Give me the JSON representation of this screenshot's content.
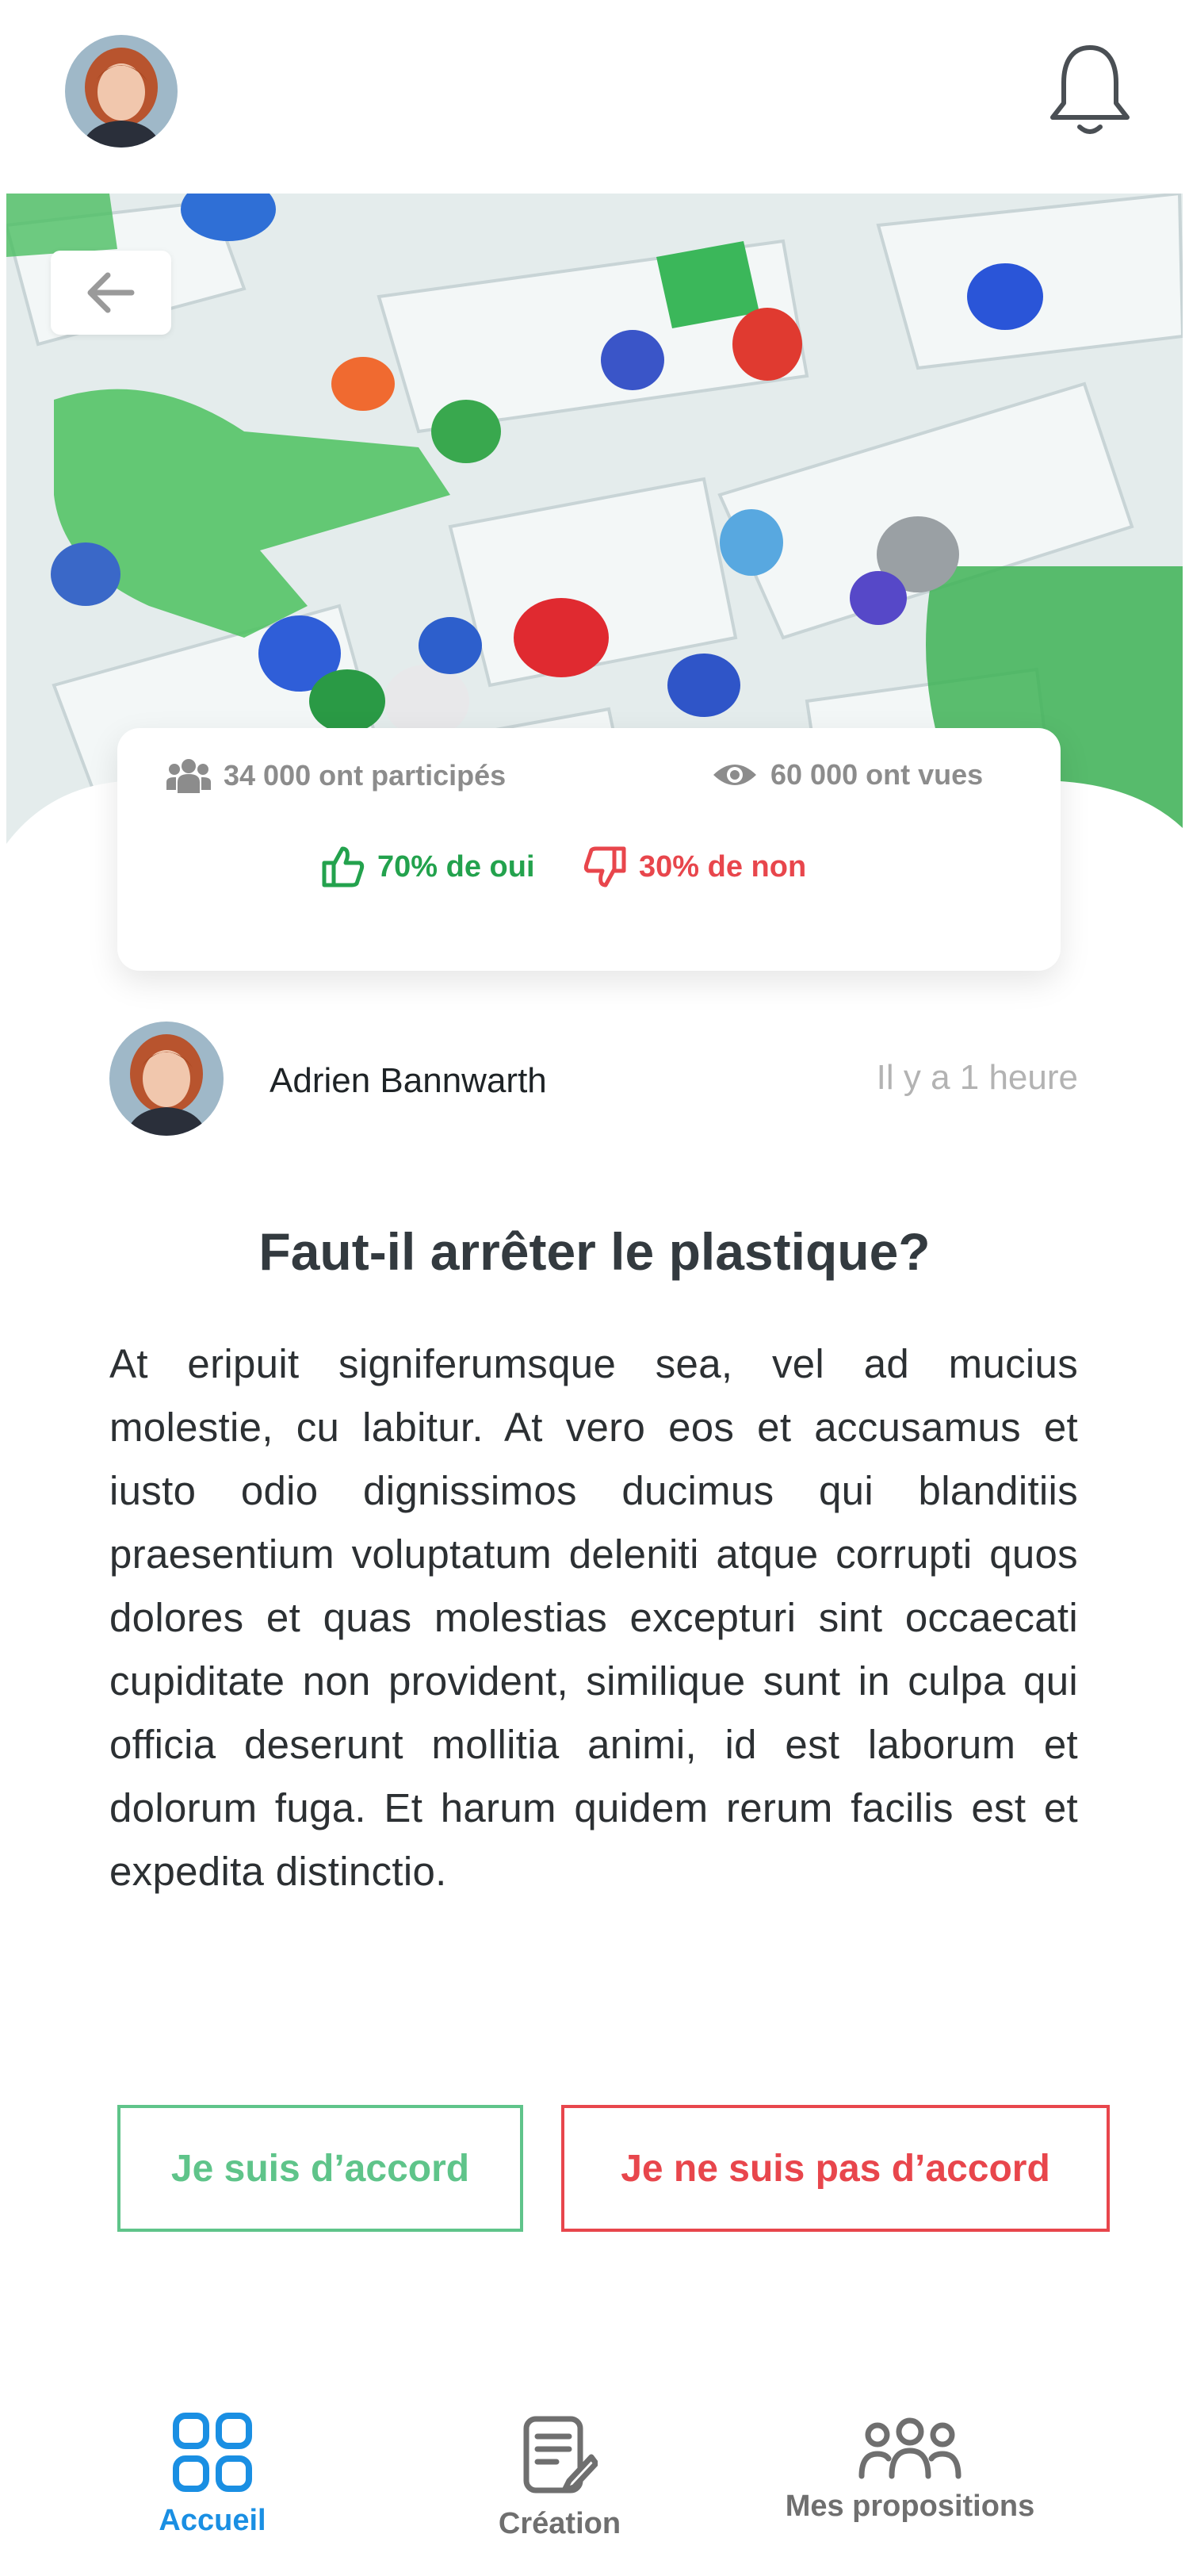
{
  "header": {
    "avatar": "user-avatar",
    "notification_icon": "bell-icon"
  },
  "hero": {
    "image": "plastic-bottles-photo",
    "back_icon": "arrow-left-icon"
  },
  "stats": {
    "participants": "34 000 ont participés",
    "views": "60 000 ont vues",
    "yes": "70% de oui",
    "no": "30% de non",
    "colors": {
      "yes": "#23a24d",
      "no": "#e8464c",
      "muted": "#8c8c8c"
    }
  },
  "author": {
    "name": "Adrien Bannwarth",
    "time": "Il y a 1 heure"
  },
  "question": {
    "title": "Faut-il arrêter le plastique?",
    "body": "At eripuit signiferumsque sea, vel ad mucius molestie, cu labitur. At vero eos et accusamus et iusto odio dignissimos ducimus qui blanditiis praesentium voluptatum deleniti atque corrupti quos dolores et quas molestias excepturi sint occaecati cupiditate non provident, similique sunt in culpa qui officia deserunt mollitia animi, id est laborum et dolorum fuga. Et harum quidem rerum facilis est et expedita distinctio."
  },
  "actions": {
    "agree": "Je suis d’accord",
    "disagree": "Je ne suis pas d’accord"
  },
  "nav": {
    "home": "Accueil",
    "create": "Création",
    "proposals": "Mes propositions",
    "active_color": "#1a8fe3"
  }
}
